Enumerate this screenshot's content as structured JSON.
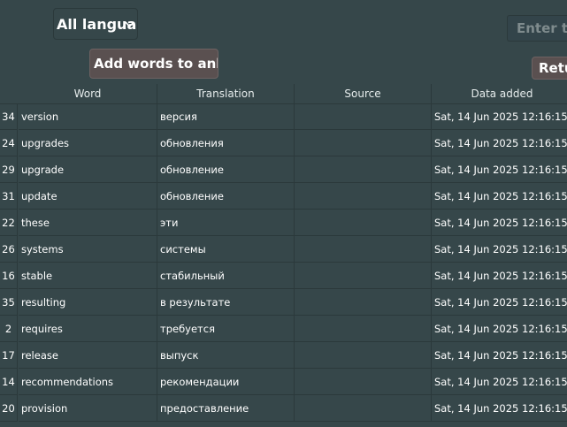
{
  "language_select": {
    "value": "All langua"
  },
  "search": {
    "placeholder": "Enter th"
  },
  "buttons": {
    "add_words": "Add words to anki",
    "return": "Retu"
  },
  "table": {
    "headers": [
      "Word",
      "Translation",
      "Source",
      "Data added"
    ],
    "rows": [
      {
        "id": "34",
        "word": "version",
        "translation": "версия",
        "source": "",
        "date": "Sat, 14 Jun 2025 12:16:15 ..."
      },
      {
        "id": "24",
        "word": "upgrades",
        "translation": "обновления",
        "source": "",
        "date": "Sat, 14 Jun 2025 12:16:15 ..."
      },
      {
        "id": "29",
        "word": "upgrade",
        "translation": "обновление",
        "source": "",
        "date": "Sat, 14 Jun 2025 12:16:15 ..."
      },
      {
        "id": "31",
        "word": "update",
        "translation": "обновление",
        "source": "",
        "date": "Sat, 14 Jun 2025 12:16:15 ..."
      },
      {
        "id": "22",
        "word": "these",
        "translation": "эти",
        "source": "",
        "date": "Sat, 14 Jun 2025 12:16:15 ..."
      },
      {
        "id": "26",
        "word": "systems",
        "translation": "системы",
        "source": "",
        "date": "Sat, 14 Jun 2025 12:16:15 ..."
      },
      {
        "id": "16",
        "word": "stable",
        "translation": "стабильный",
        "source": "",
        "date": "Sat, 14 Jun 2025 12:16:15 ..."
      },
      {
        "id": "35",
        "word": "resulting",
        "translation": "в результате",
        "source": "",
        "date": "Sat, 14 Jun 2025 12:16:15 ..."
      },
      {
        "id": "2",
        "word": "requires",
        "translation": "требуется",
        "source": "",
        "date": "Sat, 14 Jun 2025 12:16:15 ..."
      },
      {
        "id": "17",
        "word": "release",
        "translation": "выпуск",
        "source": "",
        "date": "Sat, 14 Jun 2025 12:16:15 ..."
      },
      {
        "id": "14",
        "word": "recommendations",
        "translation": "рекомендации",
        "source": "",
        "date": "Sat, 14 Jun 2025 12:16:15 ..."
      },
      {
        "id": "20",
        "word": "provision",
        "translation": "предоставление",
        "source": "",
        "date": "Sat, 14 Jun 2025 12:16:15 ..."
      }
    ]
  }
}
